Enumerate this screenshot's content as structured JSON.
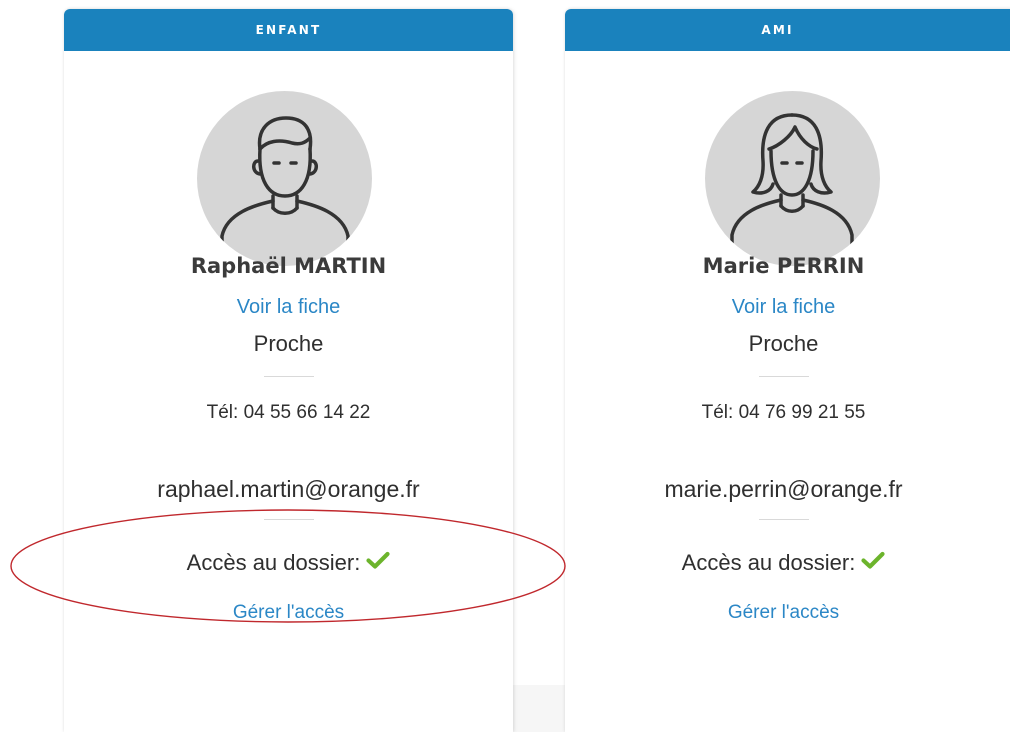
{
  "contacts": [
    {
      "category": "ENFANT",
      "name": "Raphaël MARTIN",
      "view_link": "Voir la fiche",
      "relation": "Proche",
      "phone": "Tél: 04 55 66 14 22",
      "email": "raphael.martin@orange.fr",
      "access_label": "Accès au dossier:",
      "access_granted": true,
      "manage_link": "Gérer l'accès",
      "avatar_icon": "male-avatar-icon"
    },
    {
      "category": "AMI",
      "name": "Marie PERRIN",
      "view_link": "Voir la fiche",
      "relation": "Proche",
      "phone": "Tél: 04 76 99 21 55",
      "email": "marie.perrin@orange.fr",
      "access_label": "Accès au dossier:",
      "access_granted": true,
      "manage_link": "Gérer l'accès",
      "avatar_icon": "female-avatar-icon"
    }
  ],
  "colors": {
    "header": "#1a82bd",
    "link": "#2b87c6",
    "check": "#6cb42c",
    "annotation": "#c0282d"
  }
}
